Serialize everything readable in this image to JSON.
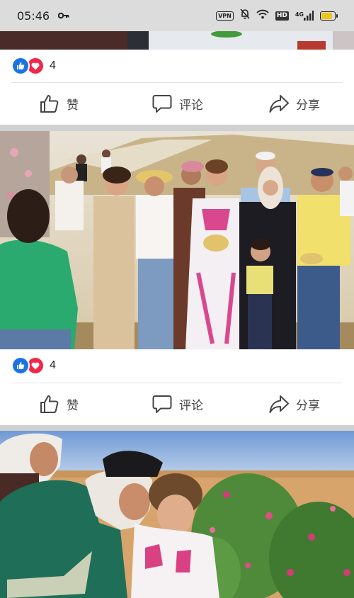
{
  "status_bar": {
    "time": "05:46",
    "vpn_label": "VPN",
    "hd_label": "HD",
    "network_label": "4G",
    "battery_level": 0.75,
    "icons": [
      "key-icon",
      "vpn-badge",
      "mute-bell-icon",
      "wifi-icon",
      "hd-badge",
      "signal-icon",
      "battery-icon"
    ]
  },
  "posts": [
    {
      "reactions": {
        "count": "4",
        "types": [
          "like",
          "love"
        ]
      },
      "actions": {
        "like": "赞",
        "comment": "评论",
        "share": "分享"
      }
    },
    {
      "reactions": {
        "count": "4",
        "types": [
          "like",
          "love"
        ]
      },
      "actions": {
        "like": "赞",
        "comment": "评论",
        "share": "分享"
      }
    }
  ],
  "colors": {
    "like_blue": "#1b74e4",
    "love_red": "#f0284a",
    "separator_gray": "#cfd0d2",
    "status_bar_bg": "#dcdcdc"
  }
}
